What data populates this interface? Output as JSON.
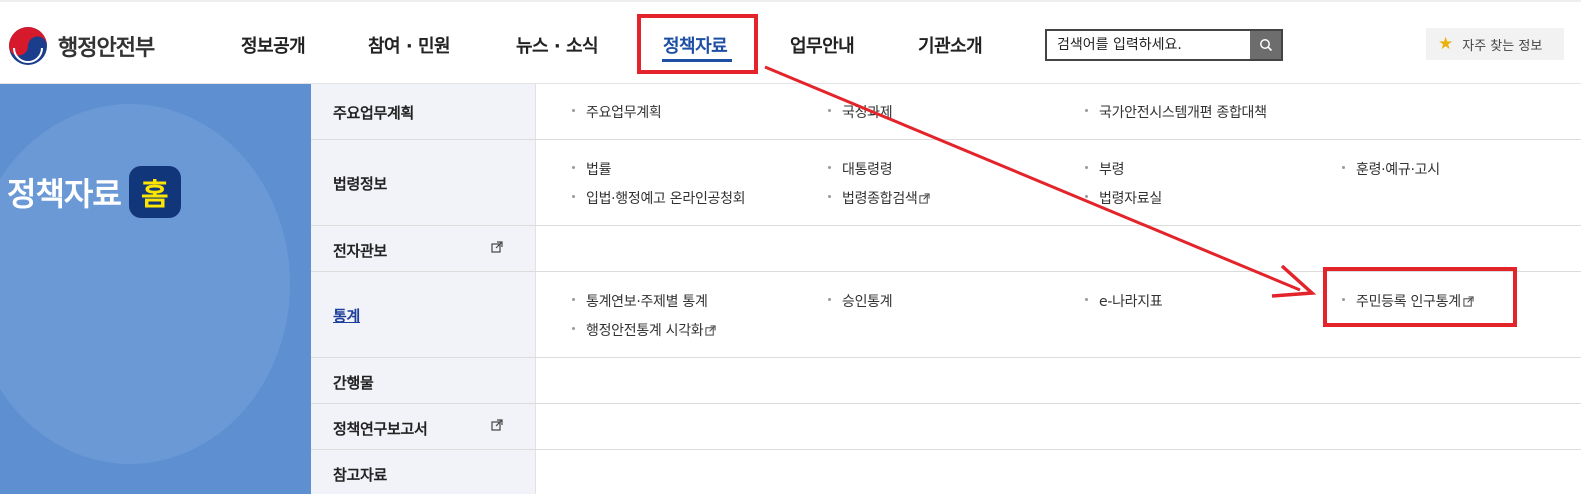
{
  "header": {
    "logo_text": "행정안전부",
    "nav": [
      {
        "label": "정보공개"
      },
      {
        "label": "참여 · 민원"
      },
      {
        "label": "뉴스 · 소식"
      },
      {
        "label": "정책자료"
      },
      {
        "label": "업무안내"
      },
      {
        "label": "기관소개"
      }
    ],
    "active_nav": "정책자료",
    "search": {
      "placeholder": "검색어를 입력하세요."
    },
    "favorites_label": "자주 찾는 정보"
  },
  "side": {
    "title": "정책자료",
    "home_badge": "홈"
  },
  "menu": {
    "rows": [
      {
        "label": "주요업무계획",
        "items": [
          "주요업무계획",
          "국정과제",
          "국가안전시스템개편 종합대책"
        ]
      },
      {
        "label": "법령정보",
        "items": [
          "법률",
          "대통령령",
          "부령",
          "훈령·예규·고시",
          "입법·행정예고 온라인공청회",
          "법령종합검색",
          "법령자료실"
        ]
      },
      {
        "label": "전자관보",
        "items": []
      },
      {
        "label": "통계",
        "items": [
          "통계연보·주제별 통계",
          "승인통계",
          "e-나라지표",
          "주민등록 인구통계",
          "행정안전통계 시각화"
        ]
      },
      {
        "label": "간행물",
        "items": []
      },
      {
        "label": "정책연구보고서",
        "items": []
      },
      {
        "label": "참고자료",
        "items": []
      }
    ]
  },
  "colors": {
    "accent_blue": "#1d4fa5",
    "side_panel": "#5e8fd0",
    "home_badge_bg": "#12367a",
    "home_badge_text": "#ffe600",
    "annotation_red": "#e3242b"
  },
  "icons": [
    "search-icon",
    "star-icon",
    "external-link-icon",
    "logo-emblem"
  ]
}
